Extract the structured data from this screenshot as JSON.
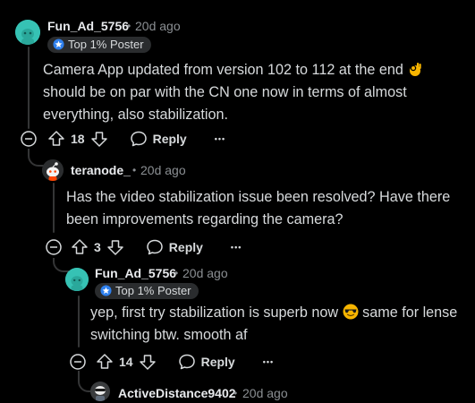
{
  "comments": [
    {
      "username": "Fun_Ad_5756",
      "age": "20d ago",
      "badge": "Top 1% Poster",
      "body_before": "Camera App updated from version 102 to 112 at the end",
      "body_after": "should be on par with the CN one now in terms of almost everything, also stabilization.",
      "emoji": "ok-hand-emoji",
      "votes": "18",
      "reply": "Reply",
      "more": "•••"
    },
    {
      "username": "teranode_",
      "age": "20d ago",
      "body": "Has the video stabilization issue been resolved? Have there been improvements regarding the camera?",
      "votes": "3",
      "reply": "Reply",
      "more": "•••"
    },
    {
      "username": "Fun_Ad_5756",
      "age": "20d ago",
      "badge": "Top 1% Poster",
      "body_before": "yep, first try stabilization is superb now",
      "body_after": "same for lense switching btw. smooth af",
      "emoji": "sunglasses-emoji",
      "votes": "14",
      "reply": "Reply",
      "more": "•••"
    },
    {
      "username": "ActiveDistance9402",
      "age": "20d ago"
    }
  ],
  "separator": "•",
  "colors": {
    "background": "#000000",
    "text": "#d7dadc",
    "meta": "#8b8f93",
    "thread_line": "#343536",
    "badge_bg": "#2a2c2e",
    "avatar_teal": "#36c2b4"
  }
}
